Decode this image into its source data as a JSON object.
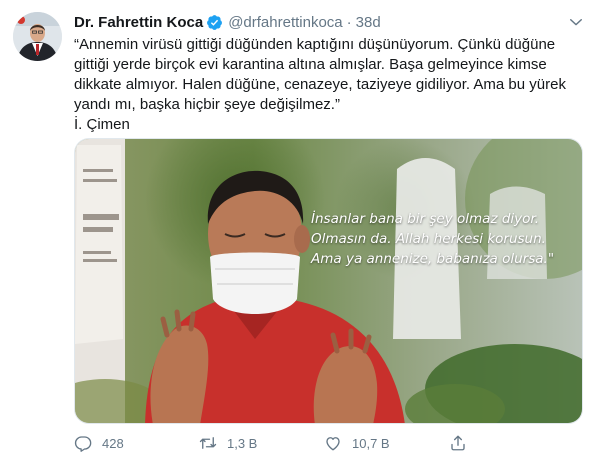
{
  "tweet": {
    "author_name": "Dr. Fahrettin Koca",
    "handle": "@drfahrettinkoca",
    "separator": "·",
    "time": "38d",
    "text": "“Annemin virüsü gittiği düğünden kaptığını düşünüyorum. Çünkü düğüne\ngittiği yerde birçok evi karantina altına almışlar. Başa gelmeyince kimse\ndikkate almıyor. Halen düğüne, cenazeye, taziyeye gidiliyor. Ama bu yürek\nyandı mı, başka hiçbir şeye değişilmez.”\nİ. Çimen",
    "image_quote": "İnsanlar bana bir şey olmaz diyor.\nOlmasın da. Allah herkesi korusun.\nAma ya annenize, babanıza olursa.\""
  },
  "actions": {
    "reply_count": "428",
    "retweet_count": "1,3 B",
    "like_count": "10,7 B"
  },
  "colors": {
    "verified": "#1da1f2",
    "secondary_text": "#657786",
    "shirt": "#c8302c"
  },
  "icons": [
    "verified-badge-icon",
    "caret-down-icon",
    "reply-icon",
    "retweet-icon",
    "like-icon",
    "share-icon"
  ]
}
